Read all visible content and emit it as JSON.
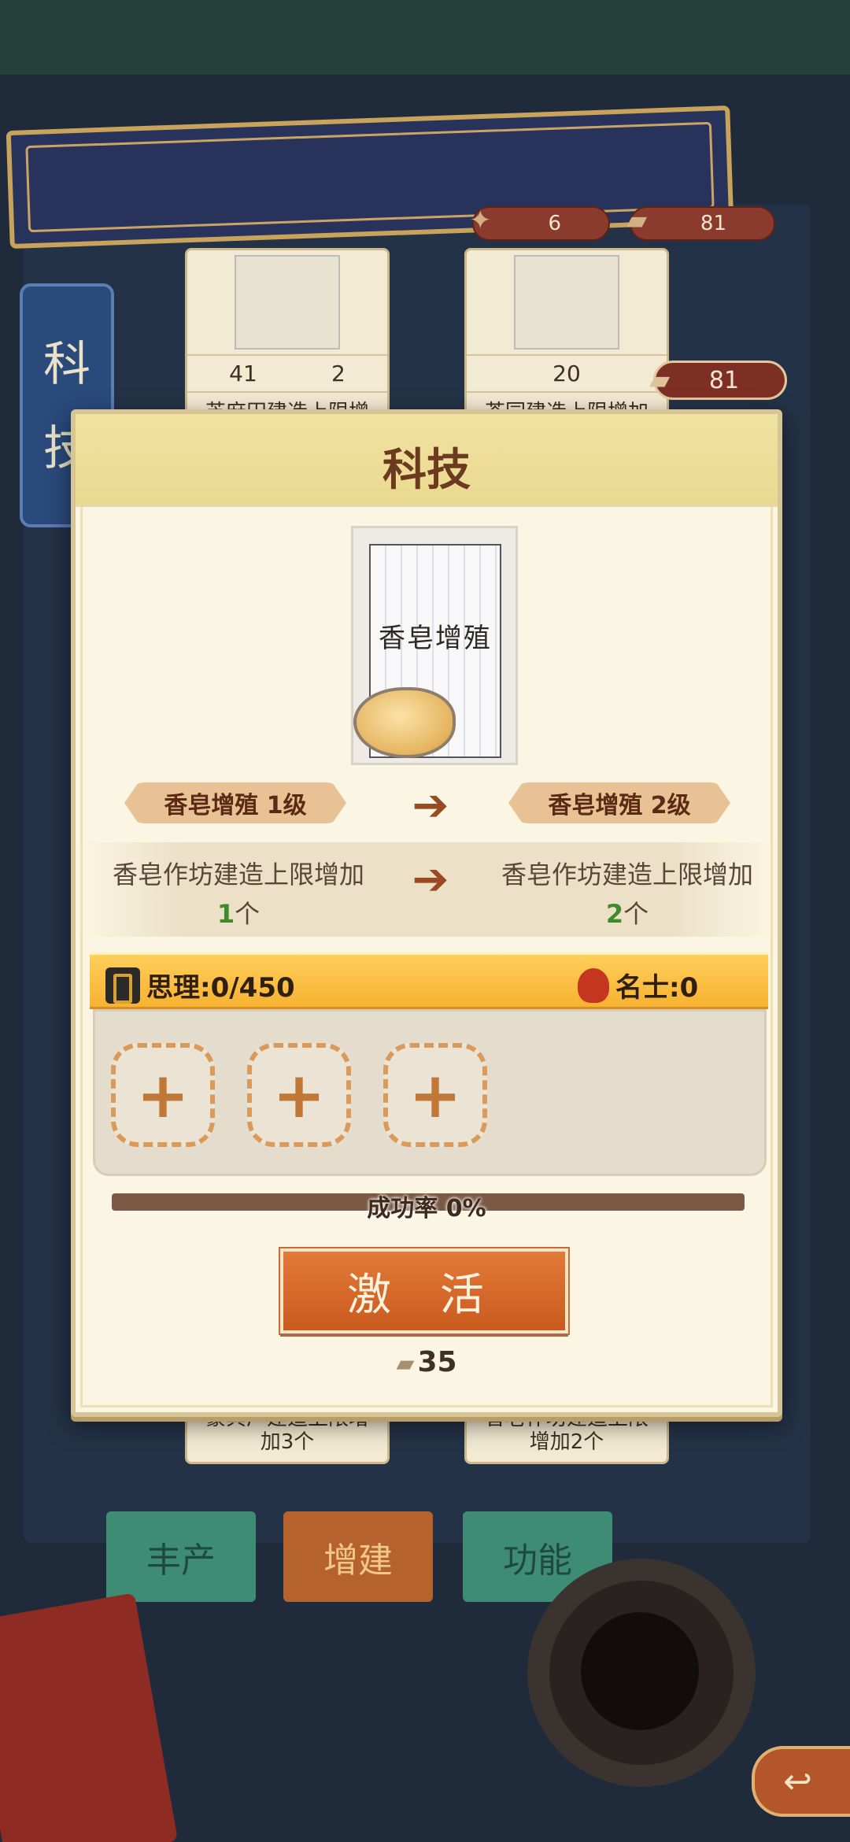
{
  "background": {
    "side_label_chars": [
      "科",
      "技"
    ],
    "resources": [
      {
        "icon": "wood-icon",
        "value": "6"
      },
      {
        "icon": "brick-icon",
        "value": "81"
      }
    ],
    "token_count": "81",
    "cards_top": [
      {
        "cost1": "41",
        "cost2": "2",
        "name": "芝麻田建造上限增"
      },
      {
        "cost1": "20",
        "name": "茶园建造上限增加"
      }
    ],
    "cards_bottom": [
      {
        "line1": "豪宾厂建造上限增",
        "line2": "加3个"
      },
      {
        "line1": "香皂作坊建造上限",
        "line2": "增加2个"
      }
    ],
    "tabs": [
      "丰产",
      "增建",
      "功能"
    ]
  },
  "dialog": {
    "title": "科技",
    "tech_card_title": "香皂增殖",
    "current_level": "香皂增殖 1级",
    "next_level": "香皂增殖 2级",
    "current_effect": "香皂作坊建造上限增加",
    "current_effect_count": "1",
    "next_effect": "香皂作坊建造上限增加",
    "next_effect_count": "2",
    "unit": "个",
    "requirement_left": "思理:0/450",
    "requirement_right": "名士:0",
    "slots": [
      "+",
      "+",
      "+"
    ],
    "success_rate_label": "成功率 0%",
    "success_rate": 0,
    "activate_label": "激 活",
    "cost": "35"
  },
  "colors": {
    "dialog_bg": "#fbf6e3",
    "title": "#6b3a1f",
    "activate": "#d4672a",
    "req_bar": "#f7b231",
    "green_number": "#3f8a2b"
  }
}
